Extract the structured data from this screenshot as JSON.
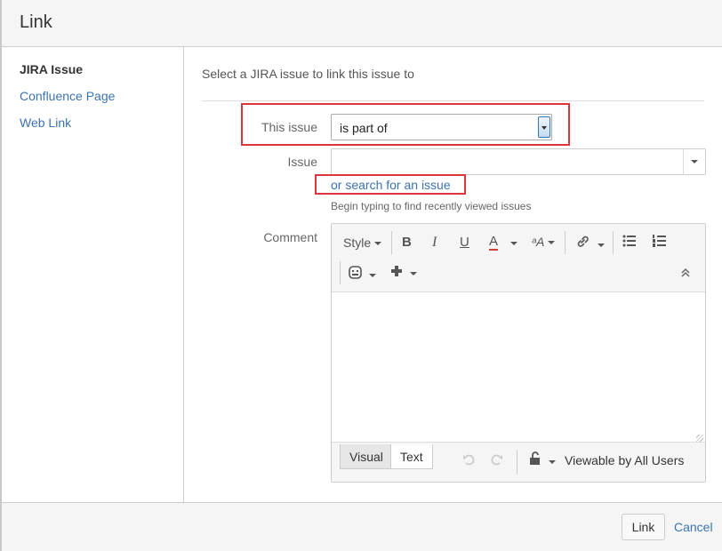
{
  "dialog": {
    "title": "Link"
  },
  "nav": {
    "items": [
      "JIRA Issue",
      "Confluence Page",
      "Web Link"
    ],
    "active": "JIRA Issue"
  },
  "form": {
    "intro": "Select a JIRA issue to link this issue to",
    "this_issue_label": "This issue",
    "relation_value": "is part of",
    "issue_label": "Issue",
    "issue_value": "",
    "search_link": "or search for an issue",
    "hint": "Begin typing to find recently viewed issues",
    "comment_label": "Comment"
  },
  "editor": {
    "toolbar": {
      "style_label": "Style",
      "bold": "B",
      "italic": "I",
      "underline": "U",
      "text_color": "A",
      "text_effects": "ᵃA",
      "link_icon": "link-icon",
      "bullet_list_icon": "bullet-list-icon",
      "numbered_list_icon": "numbered-list-icon",
      "emoticon_icon": "emoticon-icon",
      "insert_icon": "plus-icon",
      "collapse_icon": "collapse-icon"
    },
    "tabs": [
      "Visual",
      "Text"
    ],
    "active_tab": "Visual",
    "undo_icon": "undo-icon",
    "redo_icon": "redo-icon",
    "security_icon": "unlock-icon",
    "security_label": "Viewable by All Users"
  },
  "footer": {
    "link_button": "Link",
    "cancel_link": "Cancel"
  },
  "colors": {
    "link": "#3b73af",
    "highlight_box": "#d9363e",
    "text_color_underline": "#d04437"
  }
}
